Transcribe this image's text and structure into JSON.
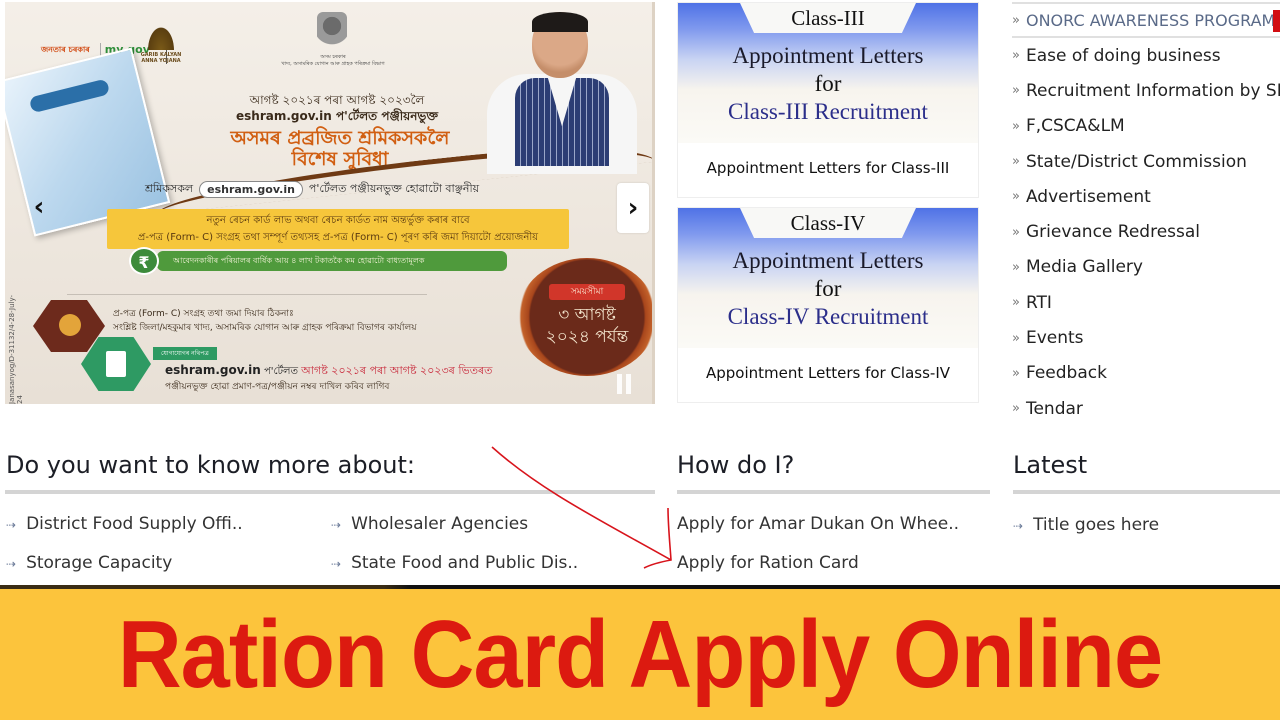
{
  "slider": {
    "prev_label": "‹",
    "next_label": "›",
    "slide": {
      "logo_jana": "জনতাৰ চৰকাৰ",
      "logo_mygov": "my gov",
      "logo_gkay": "GARIB KALYAN ANNA YOJANA",
      "govt_line1": "অসম চৰকাৰ",
      "govt_line2": "খাদ্য, অসামৰিক যোগান আৰু গ্ৰাহক পৰিক্ৰমা বিভাগ",
      "line1": "আগষ্ট ২০২১ৰ পৰা আগষ্ট ২০২৩লৈ",
      "line2": "eshram.gov.in প'ৰ্টেলত পঞ্জীয়নভুক্ত",
      "headline1": "অসমৰ প্ৰব্ৰজিত শ্ৰমিকসকলৈ",
      "headline2": "বিশেষ সুবিধা",
      "portal_prefix": "শ্ৰমিকসকল",
      "portal_pill": "eshram.gov.in",
      "portal_suffix": "প'ৰ্টেলত পঞ্জীয়নভুক্ত হোৱাটো বাঞ্ছনীয়",
      "yellow_line1": "নতুন ৰেচন কাৰ্ড লাভ অথবা ৰেচন কাৰ্ডত নাম অন্তৰ্ভুক্ত কৰাৰ বাবে",
      "yellow_line2": "প্ৰ-পত্ৰ (Form- C) সংগ্ৰহ তথা সম্পূৰ্ণ তথ্যসহ প্ৰ-পত্ৰ (Form- C) পূৰণ কৰি জমা দিয়াটো প্ৰয়োজনীয়",
      "rupee_symbol": "₹",
      "green_line": "আবেদনকাৰীৰ পৰিয়ালৰ বাৰ্ষিক আয় ৪ লাখ টকাতকৈ কম হোৱাটো বাধ্যতামূলক",
      "address_title": "প্ৰ-পত্ৰ (Form- C) সংগ্ৰহ তথা জমা দিয়াৰ ঠিকনাঃ",
      "address_line": "সংশ্লিষ্ট জিলা/মহকুমাৰ খাদ্য, অসামৰিক যোগান আৰু গ্ৰাহক পৰিক্ৰমা বিভাগৰ কাৰ্যালয়",
      "contact_tag": "যোগাযোগৰ নথিপত্ৰ",
      "eshram_bold": "eshram.gov.in",
      "eshram_mid": " প'ৰ্টেলত ",
      "eshram_red": "আগষ্ট ২০২১ৰ পৰা আগষ্ট ২০২৩ৰ ভিতৰত",
      "eshram_line2": "পঞ্জীয়নভুক্ত হোৱা প্ৰমাণ-পত্ৰ/পঞ্জীয়ন নম্বৰ দাখিল কৰিব লাগিব",
      "side_code": "Janasanyog/D-31132/4-28-July-24",
      "deadline_tag": "সময়সীমা",
      "deadline_line1": "৩ আগষ্ট",
      "deadline_line2": "২০২৪ পৰ্যন্ত"
    }
  },
  "cards": [
    {
      "tab": "Class-III",
      "line1": "Appointment Letters",
      "line2": "for",
      "line3": "Class-III Recruitment",
      "caption": "Appointment Letters for Class-III"
    },
    {
      "tab": "Class-IV",
      "line1": "Appointment Letters",
      "line2": "for",
      "line3": "Class-IV Recruitment",
      "caption": "Appointment Letters for Class-IV"
    }
  ],
  "right_menu": {
    "bullet": "»",
    "items": [
      "ONORC AWARENESS PROGRAM",
      "Ease of doing business",
      "Recruitment Information by SL",
      "F,CSCA&LM",
      "State/District Commission",
      "Advertisement",
      "Grievance Redressal",
      "Media Gallery",
      "RTI",
      "Events",
      "Feedback",
      "Tendar"
    ]
  },
  "know_more": {
    "title": "Do you want to know more about:",
    "arrow": "⇢",
    "links": [
      "District Food Supply Offi..",
      "Wholesaler Agencies",
      "Storage Capacity",
      "State Food and Public Dis.."
    ]
  },
  "how_do_i": {
    "title": "How do I?",
    "links": [
      "Apply for Amar Dukan On Whee..",
      "Apply for Ration Card"
    ]
  },
  "latest": {
    "title": "Latest",
    "arrow": "⇢",
    "items": [
      "Title goes here"
    ]
  },
  "banner": {
    "text": "Ration Card Apply Online",
    "bg_color": "#fcc43c",
    "text_color": "#dc1a10"
  },
  "annotation": {
    "color": "#d8141c"
  }
}
